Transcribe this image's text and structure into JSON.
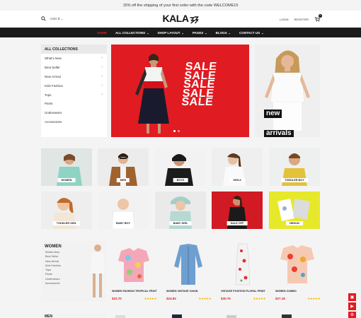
{
  "topbar": {
    "text": "15% off the shipping of your first order with the code WELCOME15"
  },
  "header": {
    "currency": "USD $",
    "logo": "KALA",
    "login": "LOGIN",
    "register": "REGISTER",
    "cart_count": "0"
  },
  "nav": [
    {
      "label": "HOME",
      "dropdown": false
    },
    {
      "label": "ALL COLLECTIONS",
      "dropdown": true
    },
    {
      "label": "SHOP LAYOUT",
      "dropdown": true
    },
    {
      "label": "PAGES",
      "dropdown": true
    },
    {
      "label": "BLOGS",
      "dropdown": true
    },
    {
      "label": "CONTACT US",
      "dropdown": true
    }
  ],
  "sidebar": {
    "title": "ALL COLLECTIONS",
    "items": [
      {
        "label": "What's New",
        "arrow": true
      },
      {
        "label": "Best Seller",
        "arrow": true
      },
      {
        "label": "New Arrival",
        "arrow": true
      },
      {
        "label": "Kids Fashion",
        "arrow": true
      },
      {
        "label": "Tops",
        "arrow": true
      },
      {
        "label": "Pants",
        "arrow": false
      },
      {
        "label": "Underwears",
        "arrow": false
      },
      {
        "label": "Accessories",
        "arrow": false
      }
    ]
  },
  "hero": {
    "lines": [
      "SALE",
      "SALE",
      "SALE",
      "SALE",
      "SALE"
    ]
  },
  "banner2": {
    "line1": "new",
    "line2": "arrivals"
  },
  "categories": [
    {
      "label": "WOMEN"
    },
    {
      "label": "MEN"
    },
    {
      "label": "BOYS"
    },
    {
      "label": "GIRLS"
    },
    {
      "label": "TODDLER BOY"
    },
    {
      "label": "TODDLER GIRL"
    },
    {
      "label": "BABY BOY"
    },
    {
      "label": "BABY GIRL"
    },
    {
      "label": "SALE OFF"
    },
    {
      "label": "NEW-IN"
    }
  ],
  "women": {
    "title": "WOMEN",
    "links": [
      "What's New",
      "Best Seller",
      "New Arrival",
      "Kids Fashion",
      "Tops",
      "Pants",
      "Underwears",
      "Accessories"
    ]
  },
  "products": [
    {
      "name": "WOMEN FASHION TROPICAL FRUIT",
      "price": "$22.70",
      "stars": "★★★★★"
    },
    {
      "name": "WOMEN VINTAGE CHAIN",
      "price": "$24.83",
      "stars": "★★★★★"
    },
    {
      "name": "VINTAGE POSITION FLORAL PRINT",
      "price": "$30.75",
      "stars": "★★★★★"
    },
    {
      "name": "WOMEN COMBO",
      "price": "$27.18",
      "stars": "★★★★★"
    }
  ],
  "next_section": {
    "title": "MEN"
  },
  "colors": {
    "accent": "#e11b22",
    "nav_bg": "#1b1b1b",
    "star": "#f5b400"
  }
}
